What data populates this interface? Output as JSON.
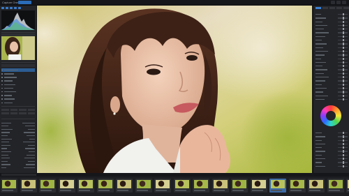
{
  "app": {
    "title": "Capture One"
  },
  "topbar": {
    "active_tab": "",
    "center_items": [
      "",
      "",
      "",
      ""
    ]
  },
  "left_panel": {
    "icons": [
      "histogram-tab-icon",
      "library-tab-icon",
      "layers-tab-icon",
      "crop-tab-icon",
      "exposure-tab-icon"
    ],
    "list_rows": 11,
    "selected_row": 0
  },
  "right_panel": {
    "tabs": 5,
    "active_tab": 0,
    "slider_rows": 25
  },
  "filmstrip": {
    "title": "",
    "frames": 19,
    "selected_frame": 14
  },
  "colors": {
    "accent": "#2b6cb8",
    "panel": "#232428",
    "background": "#1b1c1e"
  }
}
